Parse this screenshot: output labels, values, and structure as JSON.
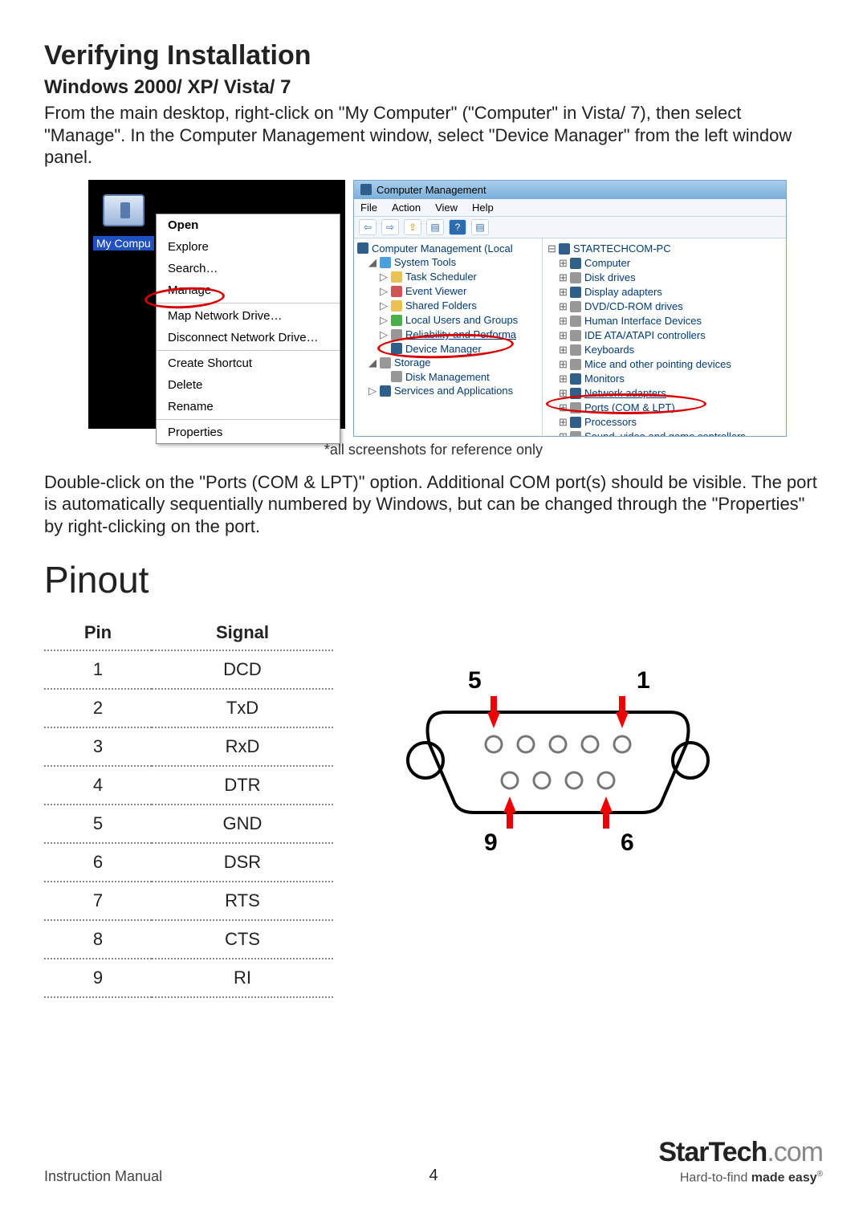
{
  "heading": "Verifying Installation",
  "subheading": "Windows 2000/ XP/ Vista/ 7",
  "para1": "From the main desktop, right-click on \"My Computer\" (\"Computer\" in Vista/ 7), then select \"Manage\". In the Computer Management window, select \"Device Manager\" from the left window panel.",
  "xp": {
    "icon_label": "My Compu",
    "menu": {
      "open": "Open",
      "explore": "Explore",
      "search": "Search…",
      "manage": "Manage",
      "map": "Map Network Drive…",
      "disconnect": "Disconnect Network Drive…",
      "shortcut": "Create Shortcut",
      "delete": "Delete",
      "rename": "Rename",
      "properties": "Properties"
    }
  },
  "win7": {
    "title": "Computer Management",
    "menubar": {
      "file": "File",
      "action": "Action",
      "view": "View",
      "help": "Help"
    },
    "toolbar_glyphs": {
      "back": "⇦",
      "fwd": "⇨",
      "up": "⇪",
      "props": "▤",
      "help": "?",
      "refresh": "▤"
    },
    "left": {
      "root": "Computer Management (Local",
      "systools": "System Tools",
      "task": "Task Scheduler",
      "event": "Event Viewer",
      "shared": "Shared Folders",
      "users": "Local Users and Groups",
      "perf": "Reliability and Performa",
      "devmgr": "Device Manager",
      "storage": "Storage",
      "disk": "Disk Management",
      "services": "Services and Applications"
    },
    "right": {
      "pc": "STARTECHCOM-PC",
      "computer": "Computer",
      "disk": "Disk drives",
      "display": "Display adapters",
      "dvd": "DVD/CD-ROM drives",
      "hid": "Human Interface Devices",
      "ide": "IDE ATA/ATAPI controllers",
      "kbd": "Keyboards",
      "mice": "Mice and other pointing devices",
      "mon": "Monitors",
      "net": "Network adapters",
      "ports": "Ports (COM & LPT)",
      "proc": "Processors",
      "sound": "Sound, video and game controllers"
    }
  },
  "caption": "*all screenshots for reference only",
  "para2": "Double-click on the \"Ports (COM & LPT)\" option. Additional COM port(s) should be visible. The port is automatically sequentially numbered by Windows, but can be changed through the \"Properties\" by right-clicking on the port.",
  "pinout_heading": "Pinout",
  "table": {
    "head_pin": "Pin",
    "head_sig": "Signal",
    "rows": [
      {
        "pin": "1",
        "sig": "DCD"
      },
      {
        "pin": "2",
        "sig": "TxD"
      },
      {
        "pin": "3",
        "sig": "RxD"
      },
      {
        "pin": "4",
        "sig": "DTR"
      },
      {
        "pin": "5",
        "sig": "GND"
      },
      {
        "pin": "6",
        "sig": "DSR"
      },
      {
        "pin": "7",
        "sig": "RTS"
      },
      {
        "pin": "8",
        "sig": "CTS"
      },
      {
        "pin": "9",
        "sig": "RI"
      }
    ]
  },
  "db9_labels": {
    "tl": "5",
    "tr": "1",
    "bl": "9",
    "br": "6"
  },
  "footer": {
    "left": "Instruction Manual",
    "page": "4",
    "logo_bold": "StarTech",
    "logo_gray": ".com",
    "tag_pre": "Hard-to-find ",
    "tag_bold": "made easy",
    "reg": "®"
  }
}
